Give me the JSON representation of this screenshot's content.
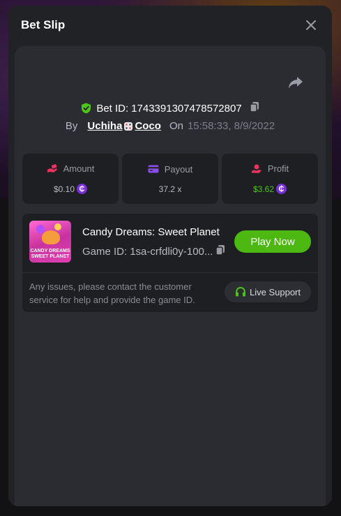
{
  "modal": {
    "title": "Bet Slip",
    "close_icon": "close-icon"
  },
  "bet": {
    "id_label": "Bet ID:",
    "id": "1743391307478572807",
    "by_label": "By",
    "user_first": "Uchiha",
    "user_second": "Coco",
    "on_label": "On",
    "timestamp": "15:58:33, 8/9/2022"
  },
  "stats": {
    "amount": {
      "label": "Amount",
      "value": "$0.10",
      "icon": "money-hand-icon"
    },
    "payout": {
      "label": "Payout",
      "value": "37.2 x",
      "icon": "card-icon"
    },
    "profit": {
      "label": "Profit",
      "value": "$3.62",
      "icon": "profit-hand-icon"
    },
    "coin_symbol": "₵"
  },
  "game": {
    "name": "Candy Dreams: Sweet Planet",
    "id_label": "Game ID:",
    "id": "1sa-crfdli0y-100...",
    "thumb_line1": "CANDY DREAMS",
    "thumb_line2": "SWEET PLANET",
    "play_label": "Play Now"
  },
  "support": {
    "text": "Any issues, please contact the customer service for help and provide the game ID.",
    "button_label": "Live Support"
  },
  "colors": {
    "accent_green": "#4cb811",
    "profit_green": "#4cc419",
    "coin_purple": "#7a2fd8",
    "shield_green": "#4cc419"
  }
}
